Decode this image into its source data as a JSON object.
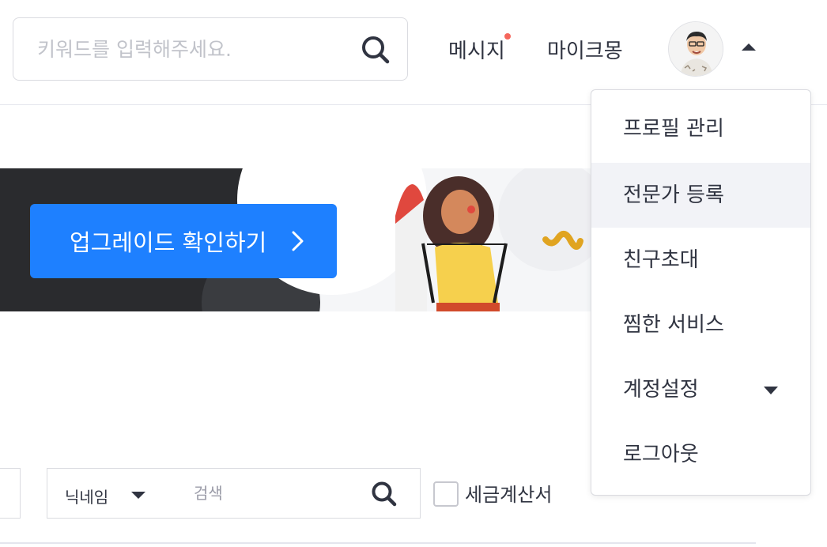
{
  "header": {
    "search_placeholder": "키워드를 입력해주세요.",
    "message_label": "메시지",
    "mykmong_label": "마이크몽",
    "has_new_message": true
  },
  "banner": {
    "button_label": "업그레이드 확인하기"
  },
  "dropdown": {
    "items": [
      {
        "label": "프로필 관리"
      },
      {
        "label": "전문가 등록"
      },
      {
        "label": "친구초대"
      },
      {
        "label": "찜한 서비스"
      },
      {
        "label": "계정설정"
      },
      {
        "label": "로그아웃"
      }
    ]
  },
  "filter": {
    "select_value": "닉네임",
    "search_placeholder": "검색",
    "tax_invoice_label": "세금계산서"
  },
  "colors": {
    "accent": "#1e80ff",
    "notification_dot": "#f5665c",
    "text": "#303441",
    "banner_dark": "#2a2b2e"
  }
}
